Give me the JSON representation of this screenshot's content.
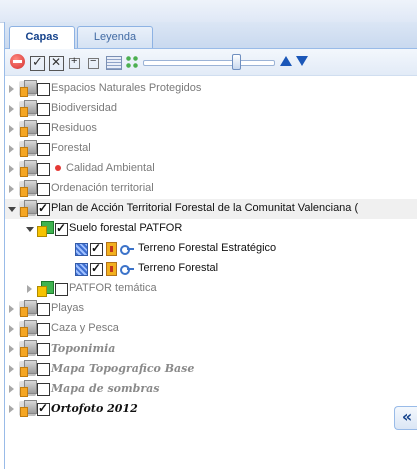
{
  "tabs": [
    {
      "label": "Capas",
      "active": true
    },
    {
      "label": "Leyenda",
      "active": false
    }
  ],
  "toolbar": {
    "icons": [
      "remove-layer-icon",
      "check-all-icon",
      "uncheck-all-icon",
      "expand-all-icon",
      "collapse-all-icon",
      "attribute-table-icon",
      "grid-icon",
      "opacity-slider",
      "move-up-icon",
      "move-down-icon"
    ],
    "opacity_level": 0.72
  },
  "tree": [
    {
      "label": "Espacios Naturales Protegidos",
      "expanded": false,
      "checked": false
    },
    {
      "label": "Biodiversidad",
      "expanded": false,
      "checked": false
    },
    {
      "label": "Residuos",
      "expanded": false,
      "checked": false
    },
    {
      "label": "Forestal",
      "expanded": false,
      "checked": false
    },
    {
      "label": "Calidad Ambiental",
      "expanded": false,
      "checked": false,
      "status_dot": "#e53935"
    },
    {
      "label": "Ordenación territorial",
      "expanded": false,
      "checked": false
    },
    {
      "label": "Plan de Acción Territorial Forestal de la Comunitat Valenciana (",
      "expanded": true,
      "checked": true,
      "selected": true
    },
    {
      "label": "Suelo forestal PATFOR",
      "expanded": true,
      "checked": true
    },
    {
      "label": "Terreno Forestal Estratégico",
      "checked": true
    },
    {
      "label": "Terreno Forestal",
      "checked": true
    },
    {
      "label": "PATFOR temática",
      "expanded": false,
      "checked": false
    },
    {
      "label": "Playas",
      "expanded": false,
      "checked": false
    },
    {
      "label": "Caza y Pesca",
      "expanded": false,
      "checked": false
    },
    {
      "label": "Toponimia",
      "expanded": false,
      "checked": false
    },
    {
      "label": "Mapa Topografico Base",
      "expanded": false,
      "checked": false
    },
    {
      "label": "Mapa de sombras",
      "expanded": false,
      "checked": false
    },
    {
      "label": "Ortofoto 2012",
      "expanded": false,
      "checked": true
    }
  ],
  "collapse_button": "«"
}
